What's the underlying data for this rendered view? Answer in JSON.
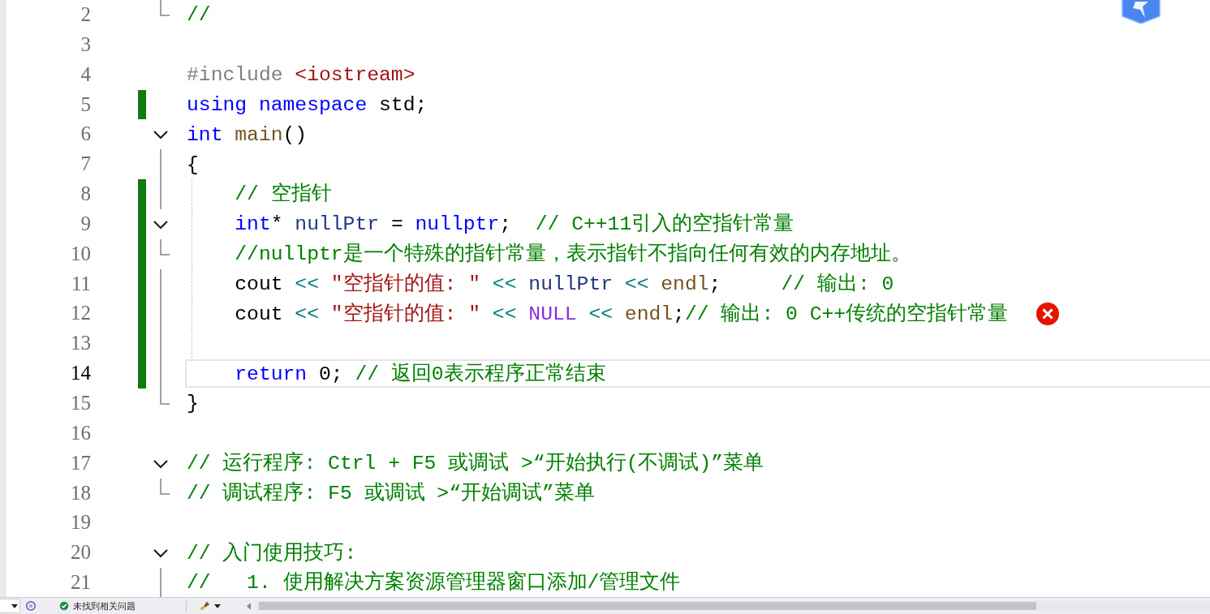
{
  "editor": {
    "lines": [
      {
        "number": "2",
        "changed": false,
        "fold": {
          "kind": "end"
        },
        "tokens": [
          {
            "text": "//",
            "kind": "comment"
          }
        ]
      },
      {
        "number": "3",
        "changed": false
      },
      {
        "number": "4",
        "changed": false,
        "tokens": [
          {
            "text": "#include",
            "kind": "preproc"
          },
          {
            "text": " <iostream>",
            "kind": "string"
          }
        ]
      },
      {
        "number": "5",
        "changed": true,
        "tokens": [
          {
            "text": "using",
            "kind": "keyword"
          },
          {
            "text": " namespace",
            "kind": "keyword"
          },
          {
            "text": " std;",
            "kind": "plain"
          }
        ]
      },
      {
        "number": "6",
        "changed": false,
        "fold": {
          "kind": "collapse"
        },
        "tokens": [
          {
            "text": "int",
            "kind": "keyword"
          },
          {
            "text": " main",
            "kind": "function"
          },
          {
            "text": "()",
            "kind": "plain"
          }
        ]
      },
      {
        "number": "7",
        "changed": false,
        "fold": {
          "kind": "line"
        },
        "tokens": [
          {
            "text": "{",
            "kind": "plain"
          }
        ]
      },
      {
        "number": "8",
        "changed": true,
        "indented": true,
        "fold": {
          "kind": "line"
        },
        "guide": true,
        "tokens": [
          {
            "text": "// 空指针",
            "kind": "comment"
          }
        ]
      },
      {
        "number": "9",
        "changed": true,
        "indented": true,
        "fold": {
          "kind": "collapse"
        },
        "guide": true,
        "tokens": [
          {
            "text": "int",
            "kind": "keyword"
          },
          {
            "text": "* ",
            "kind": "plain"
          },
          {
            "text": "nullPtr",
            "kind": "variable"
          },
          {
            "text": " = ",
            "kind": "plain"
          },
          {
            "text": "nullptr",
            "kind": "keyword"
          },
          {
            "text": ";  ",
            "kind": "plain"
          },
          {
            "text": "// C++11引入的空指针常量",
            "kind": "comment"
          }
        ]
      },
      {
        "number": "10",
        "changed": true,
        "indented": true,
        "fold": {
          "kind": "end"
        },
        "guide": true,
        "tokens": [
          {
            "text": "//nullptr是一个特殊的指针常量，表示指针不指向任何有效的内存地址。",
            "kind": "comment"
          }
        ]
      },
      {
        "number": "11",
        "changed": true,
        "indented": true,
        "fold": {
          "kind": "line"
        },
        "guide": true,
        "tokens": [
          {
            "text": "cout ",
            "kind": "plain"
          },
          {
            "text": "<< ",
            "kind": "operator"
          },
          {
            "text": "\"空指针的值: \"",
            "kind": "string"
          },
          {
            "text": " <<",
            "kind": "operator"
          },
          {
            "text": " nullPtr",
            "kind": "variable"
          },
          {
            "text": " <<",
            "kind": "operator"
          },
          {
            "text": " endl",
            "kind": "function"
          },
          {
            "text": ";     ",
            "kind": "plain"
          },
          {
            "text": "// 输出: 0",
            "kind": "comment"
          }
        ]
      },
      {
        "number": "12",
        "changed": true,
        "indented": true,
        "fold": {
          "kind": "line"
        },
        "guide": true,
        "error": true,
        "tokens": [
          {
            "text": "cout ",
            "kind": "plain"
          },
          {
            "text": "<< ",
            "kind": "operator"
          },
          {
            "text": "\"空指针的值: \"",
            "kind": "string"
          },
          {
            "text": " <<",
            "kind": "operator"
          },
          {
            "text": " NULL",
            "kind": "macro"
          },
          {
            "text": " <<",
            "kind": "operator"
          },
          {
            "text": " endl",
            "kind": "function"
          },
          {
            "text": ";",
            "kind": "plain"
          },
          {
            "text": "// 输出: 0 C++传统的空指针常量",
            "kind": "comment"
          }
        ]
      },
      {
        "number": "13",
        "changed": true,
        "fold": {
          "kind": "line"
        },
        "guide": true
      },
      {
        "number": "14",
        "changed": true,
        "indented": true,
        "fold": {
          "kind": "line"
        },
        "current": true,
        "tokens": [
          {
            "text": "return",
            "kind": "keyword"
          },
          {
            "text": " 0; ",
            "kind": "plain"
          },
          {
            "text": "// 返回0表示程序正常结束",
            "kind": "comment"
          }
        ]
      },
      {
        "number": "15",
        "changed": false,
        "fold": {
          "kind": "end"
        },
        "tokens": [
          {
            "text": "}",
            "kind": "plain"
          }
        ]
      },
      {
        "number": "16",
        "changed": false
      },
      {
        "number": "17",
        "changed": false,
        "fold": {
          "kind": "collapse"
        },
        "tokens": [
          {
            "text": "// 运行程序: Ctrl + F5 或调试 >“开始执行(不调试)”菜单",
            "kind": "comment"
          }
        ]
      },
      {
        "number": "18",
        "changed": false,
        "fold": {
          "kind": "end"
        },
        "tokens": [
          {
            "text": "// 调试程序: F5 或调试 >“开始调试”菜单",
            "kind": "comment"
          }
        ]
      },
      {
        "number": "19",
        "changed": false
      },
      {
        "number": "20",
        "changed": false,
        "fold": {
          "kind": "collapse"
        },
        "tokens": [
          {
            "text": "// 入门使用技巧: ",
            "kind": "comment"
          }
        ]
      },
      {
        "number": "21",
        "changed": false,
        "fold": {
          "kind": "line"
        },
        "tokens": [
          {
            "text": "//   1. 使用解决方案资源管理器窗口添加/管理文件",
            "kind": "comment"
          }
        ]
      }
    ]
  },
  "status_bar": {
    "issues": "未找到相关问题"
  }
}
